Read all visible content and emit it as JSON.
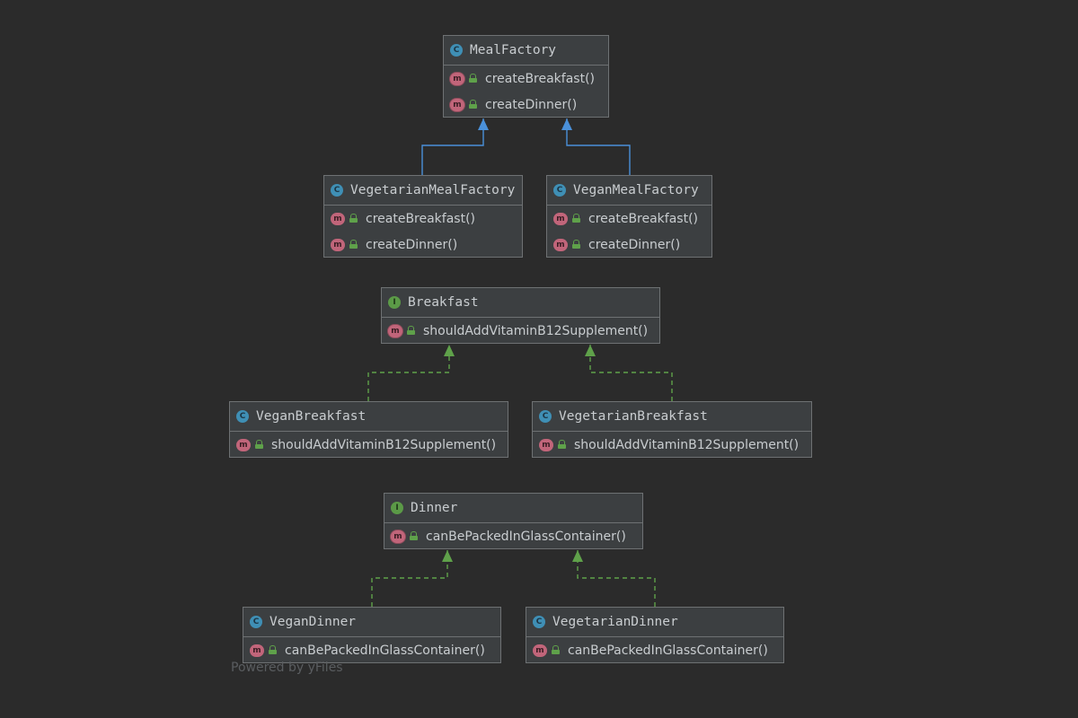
{
  "diagram": {
    "watermark": "Powered by yFiles",
    "nodes": {
      "meal_factory": {
        "kind": "class",
        "kind_letter": "C",
        "name": "MealFactory",
        "members": [
          "createBreakfast()",
          "createDinner()"
        ]
      },
      "vegetarian_meal_factory": {
        "kind": "class",
        "kind_letter": "C",
        "name": "VegetarianMealFactory",
        "members": [
          "createBreakfast()",
          "createDinner()"
        ]
      },
      "vegan_meal_factory": {
        "kind": "class",
        "kind_letter": "C",
        "name": "VeganMealFactory",
        "members": [
          "createBreakfast()",
          "createDinner()"
        ]
      },
      "breakfast": {
        "kind": "interface",
        "kind_letter": "I",
        "name": "Breakfast",
        "members": [
          "shouldAddVitaminB12Supplement()"
        ]
      },
      "vegan_breakfast": {
        "kind": "class",
        "kind_letter": "C",
        "name": "VeganBreakfast",
        "members": [
          "shouldAddVitaminB12Supplement()"
        ]
      },
      "vegetarian_breakfast": {
        "kind": "class",
        "kind_letter": "C",
        "name": "VegetarianBreakfast",
        "members": [
          "shouldAddVitaminB12Supplement()"
        ]
      },
      "dinner": {
        "kind": "interface",
        "kind_letter": "I",
        "name": "Dinner",
        "members": [
          "canBePackedInGlassContainer()"
        ]
      },
      "vegan_dinner": {
        "kind": "class",
        "kind_letter": "C",
        "name": "VeganDinner",
        "members": [
          "canBePackedInGlassContainer()"
        ]
      },
      "vegetarian_dinner": {
        "kind": "class",
        "kind_letter": "C",
        "name": "VegetarianDinner",
        "members": [
          "canBePackedInGlassContainer()"
        ]
      }
    },
    "method_icon_letter": "m",
    "edges": [
      {
        "from": "vegetarian_meal_factory",
        "to": "meal_factory",
        "type": "extends"
      },
      {
        "from": "vegan_meal_factory",
        "to": "meal_factory",
        "type": "extends"
      },
      {
        "from": "vegan_breakfast",
        "to": "breakfast",
        "type": "implements"
      },
      {
        "from": "vegetarian_breakfast",
        "to": "breakfast",
        "type": "implements"
      },
      {
        "from": "vegan_dinner",
        "to": "dinner",
        "type": "implements"
      },
      {
        "from": "vegetarian_dinner",
        "to": "dinner",
        "type": "implements"
      }
    ],
    "colors": {
      "extends": "#4a90d9",
      "implements": "#5fa14a",
      "class_icon": "#3f8fb5",
      "interface_icon": "#5b9a47",
      "method_icon": "#c1657a"
    }
  }
}
